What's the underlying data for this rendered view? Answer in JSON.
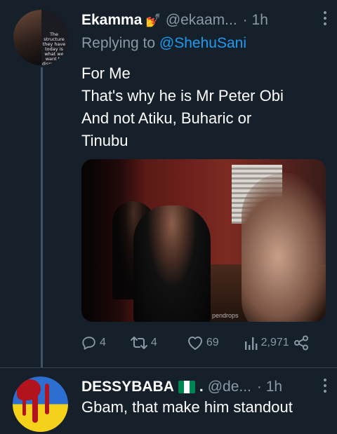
{
  "tweet1": {
    "display_name": "Ekamma",
    "badge": "💅",
    "handle": "@ekaam...",
    "separator": "·",
    "time": "1h",
    "avatar_quote": "The structure they have today is what we want to dismantle. It is a structure for criminality",
    "replying_prefix": "Replying to",
    "replying_mention": "@ShehuSani",
    "text_lines": [
      "For Me",
      "That's why he is Mr Peter Obi",
      "And not Atiku, Buharic or",
      "Tinubu"
    ],
    "media_watermark": "pendrops",
    "stats": {
      "replies": "4",
      "retweets": "4",
      "likes": "69",
      "views": "2,971"
    }
  },
  "tweet2": {
    "display_name": "DESSYBABA",
    "suffix": ".",
    "handle": "@de...",
    "separator": "·",
    "time": "1h",
    "text": "Gbam, that make him standout"
  },
  "icons": {
    "reply": "reply-icon",
    "retweet": "retweet-icon",
    "like": "heart-icon",
    "views": "analytics-icon",
    "share": "share-icon",
    "more": "more-vertical-icon"
  },
  "colors": {
    "background": "#15202b",
    "text": "#ffffff",
    "muted": "#8b98a5",
    "link": "#1d9bf0",
    "flag_green": "#008751"
  }
}
